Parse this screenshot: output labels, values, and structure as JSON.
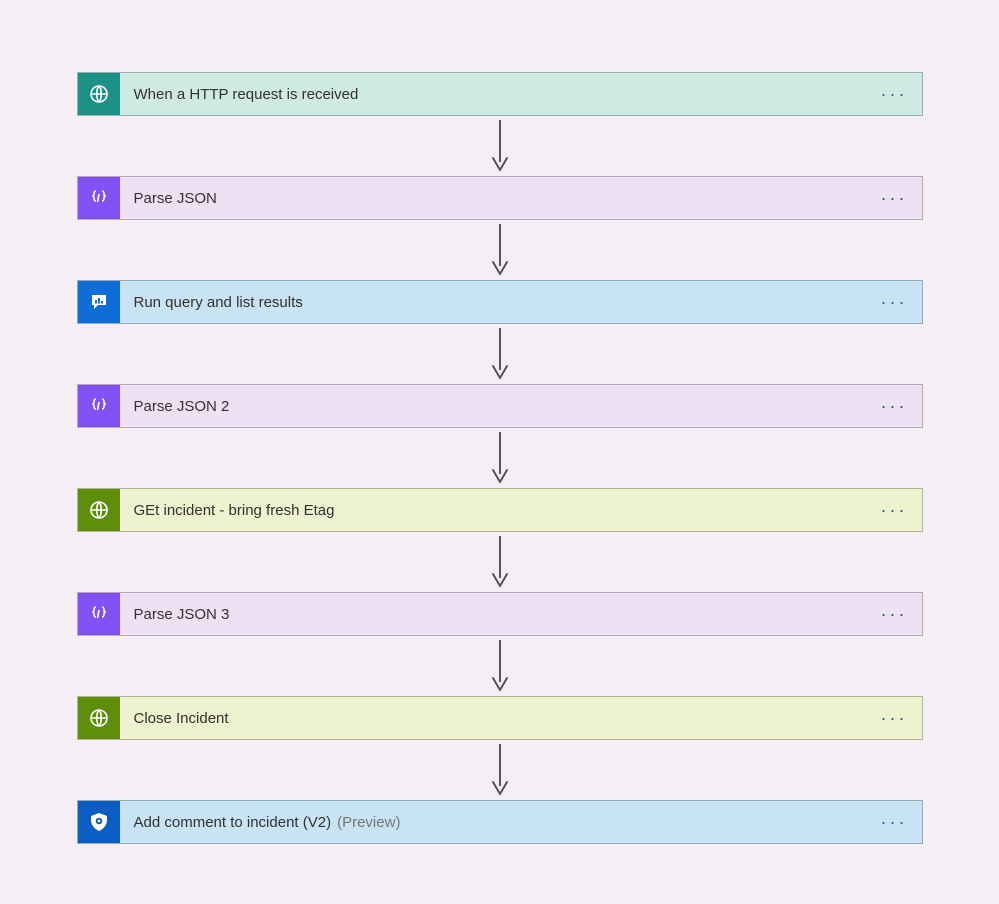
{
  "steps": [
    {
      "label": "When a HTTP request is received",
      "suffix": "",
      "icon": "globe-icon",
      "bg": "bg-teal",
      "iconBg": "ic-teal"
    },
    {
      "label": "Parse JSON",
      "suffix": "",
      "icon": "json-icon",
      "bg": "bg-lav",
      "iconBg": "ic-violet"
    },
    {
      "label": "Run query and list results",
      "suffix": "",
      "icon": "query-icon",
      "bg": "bg-sky",
      "iconBg": "ic-blue"
    },
    {
      "label": "Parse JSON 2",
      "suffix": "",
      "icon": "json-icon",
      "bg": "bg-lav",
      "iconBg": "ic-violet"
    },
    {
      "label": "GEt incident - bring fresh Etag",
      "suffix": "",
      "icon": "globe-icon",
      "bg": "bg-olive",
      "iconBg": "ic-olive"
    },
    {
      "label": "Parse JSON 3",
      "suffix": "",
      "icon": "json-icon",
      "bg": "bg-lav",
      "iconBg": "ic-violet"
    },
    {
      "label": "Close Incident",
      "suffix": "",
      "icon": "globe-icon",
      "bg": "bg-olive",
      "iconBg": "ic-olive"
    },
    {
      "label": "Add comment to incident (V2)",
      "suffix": "(Preview)",
      "icon": "shield-icon",
      "bg": "bg-sky",
      "iconBg": "ic-navy"
    }
  ],
  "moreLabel": "···"
}
